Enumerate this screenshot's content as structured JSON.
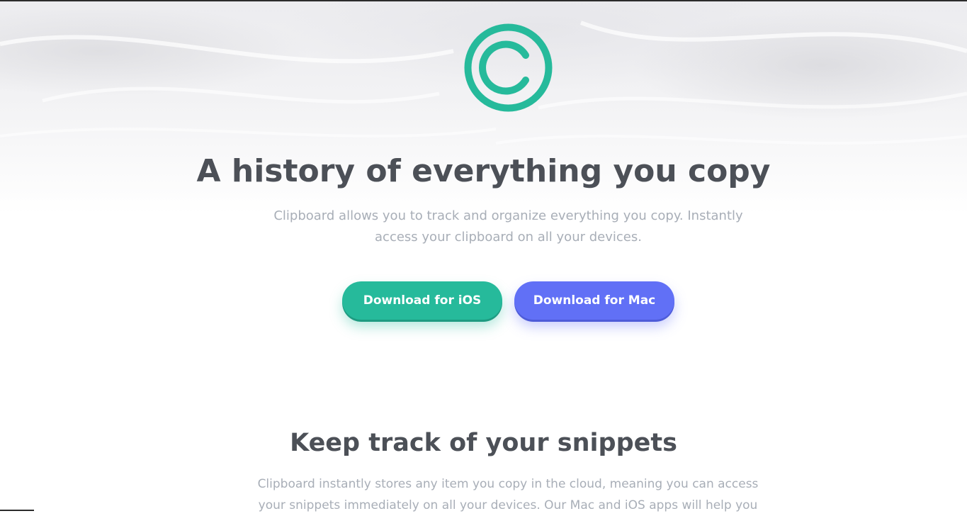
{
  "hero": {
    "logo_icon": "copyright-circle-icon",
    "title": "A history of everything you copy",
    "description": "Clipboard allows you to track and organize everything you copy. Instantly access your clipboard on all your devices.",
    "buttons": {
      "ios_label": "Download for iOS",
      "mac_label": "Download for Mac"
    }
  },
  "snippets": {
    "title": "Keep track of your snippets",
    "description": "Clipboard instantly stores any item you copy in the cloud, meaning you can access your snippets immediately on all your devices. Our Mac and iOS apps will help you"
  },
  "colors": {
    "accent_teal": "#26ba9b",
    "accent_blue": "#6170f6",
    "heading": "#4c5057",
    "body_text": "#a8aeb7"
  }
}
